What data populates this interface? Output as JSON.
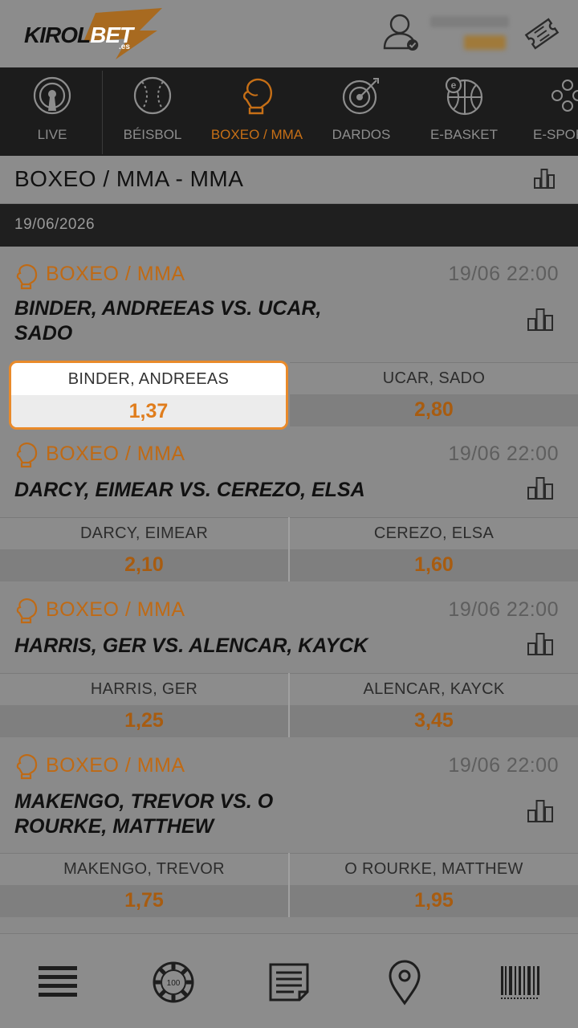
{
  "header": {
    "logo_text": "KIROL",
    "logo_bet": "BET",
    "logo_domain": ".es"
  },
  "sports": [
    {
      "label": "LIVE",
      "icon": "live-icon",
      "active": false
    },
    {
      "label": "BÉISBOL",
      "icon": "baseball-icon",
      "active": false
    },
    {
      "label": "BOXEO / MMA",
      "icon": "boxing-glove-icon",
      "active": true
    },
    {
      "label": "DARDOS",
      "icon": "darts-icon",
      "active": false
    },
    {
      "label": "E-BASKET",
      "icon": "ebasket-icon",
      "active": false
    },
    {
      "label": "E-SPOR",
      "icon": "esports-icon",
      "active": false
    }
  ],
  "page_title": "BOXEO / MMA - MMA",
  "date": "19/06/2026",
  "events": [
    {
      "league": "BOXEO / MMA",
      "time": "19/06 22:00",
      "teams": "BINDER, ANDREEAS VS. UCAR, SADO",
      "home_name": "BINDER, ANDREEAS",
      "home_odd": "1,37",
      "away_name": "UCAR, SADO",
      "away_odd": "2,80"
    },
    {
      "league": "BOXEO / MMA",
      "time": "19/06 22:00",
      "teams": "DARCY, EIMEAR VS. CEREZO, ELSA",
      "home_name": "DARCY, EIMEAR",
      "home_odd": "2,10",
      "away_name": "CEREZO, ELSA",
      "away_odd": "1,60"
    },
    {
      "league": "BOXEO / MMA",
      "time": "19/06 22:00",
      "teams": "HARRIS, GER VS. ALENCAR, KAYCK",
      "home_name": "HARRIS, GER",
      "home_odd": "1,25",
      "away_name": "ALENCAR, KAYCK",
      "away_odd": "3,45"
    },
    {
      "league": "BOXEO / MMA",
      "time": "19/06 22:00",
      "teams": "MAKENGO, TREVOR VS. O ROURKE, MATTHEW",
      "home_name": "MAKENGO, TREVOR",
      "home_odd": "1,75",
      "away_name": "O ROURKE, MATTHEW",
      "away_odd": "1,95"
    }
  ],
  "bottom_nav": [
    {
      "icon": "menu-icon"
    },
    {
      "icon": "casino-chip-icon",
      "chip_label": "100"
    },
    {
      "icon": "bet-slip-icon"
    },
    {
      "icon": "location-pin-icon"
    },
    {
      "icon": "barcode-icon"
    }
  ],
  "colors": {
    "accent": "#e07d1c",
    "league": "#bf6a15",
    "sportbar_bg": "#1c1c1c",
    "highlight_border": "#e98a2a"
  }
}
